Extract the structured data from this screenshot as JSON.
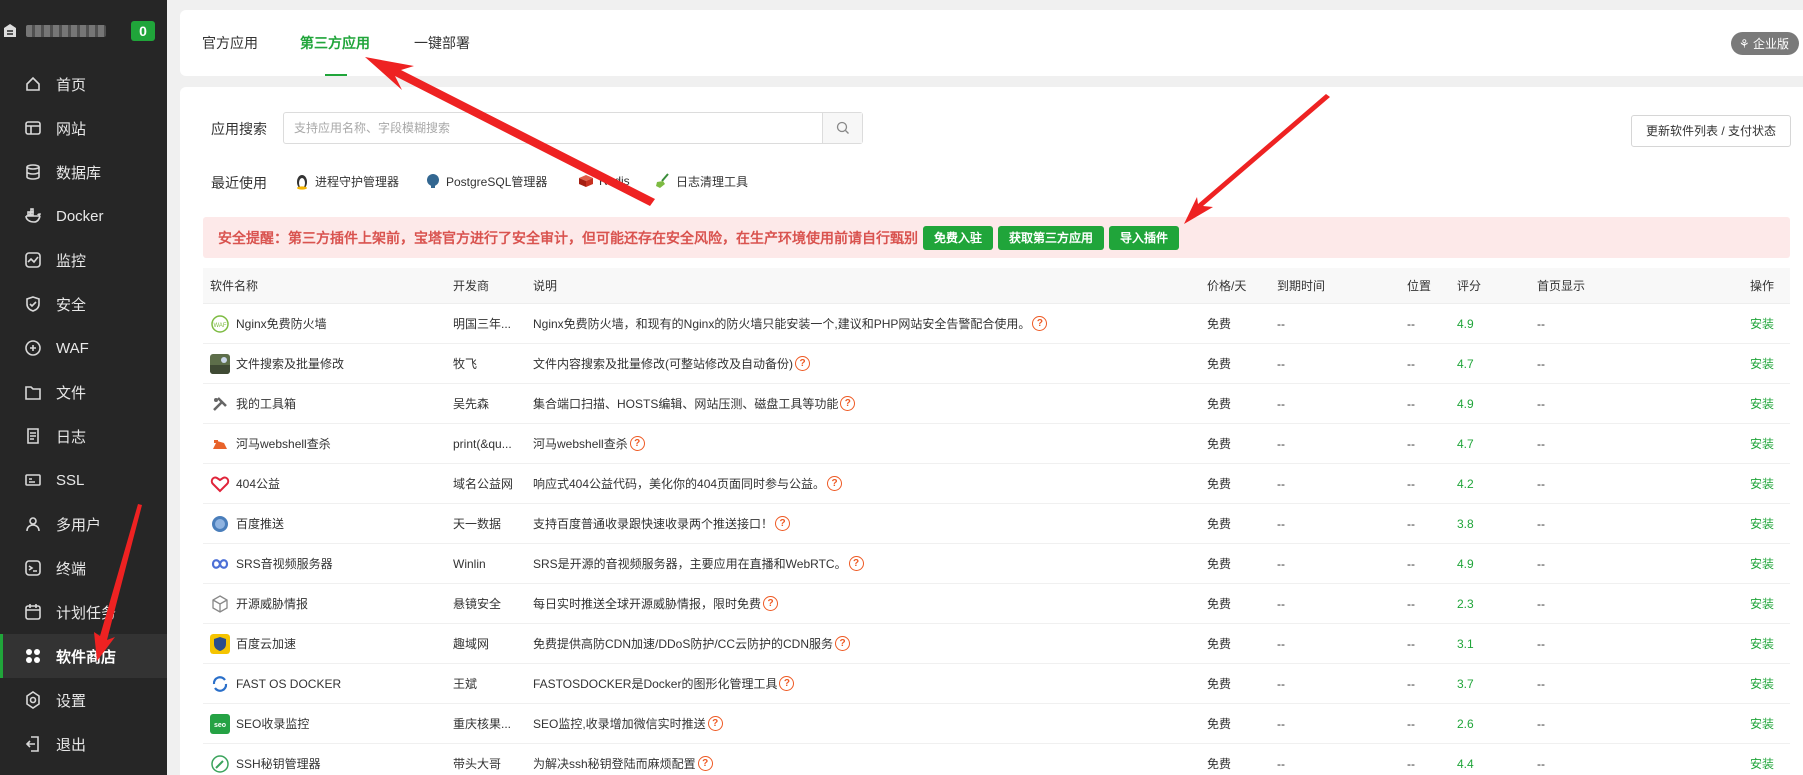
{
  "sidebar": {
    "badge": "0",
    "items": [
      {
        "label": "首页",
        "icon": "home-icon"
      },
      {
        "label": "网站",
        "icon": "website-icon"
      },
      {
        "label": "数据库",
        "icon": "database-icon"
      },
      {
        "label": "Docker",
        "icon": "docker-icon"
      },
      {
        "label": "监控",
        "icon": "monitor-icon"
      },
      {
        "label": "安全",
        "icon": "shield-icon"
      },
      {
        "label": "WAF",
        "icon": "waf-icon"
      },
      {
        "label": "文件",
        "icon": "folder-icon"
      },
      {
        "label": "日志",
        "icon": "log-icon"
      },
      {
        "label": "SSL",
        "icon": "ssl-icon"
      },
      {
        "label": "多用户",
        "icon": "user-icon"
      },
      {
        "label": "终端",
        "icon": "terminal-icon"
      },
      {
        "label": "计划任务",
        "icon": "calendar-icon"
      },
      {
        "label": "软件商店",
        "icon": "apps-icon",
        "active": true
      },
      {
        "label": "设置",
        "icon": "settings-icon"
      },
      {
        "label": "退出",
        "icon": "logout-icon"
      }
    ]
  },
  "tabs": {
    "official": "官方应用",
    "third_party": "第三方应用",
    "one_click": "一键部署",
    "enterprise": "企业版"
  },
  "search": {
    "label": "应用搜索",
    "placeholder": "支持应用名称、字段模糊搜索"
  },
  "update_button": "更新软件列表 / 支付状态",
  "recent": {
    "label": "最近使用",
    "items": [
      "进程守护管理器",
      "PostgreSQL管理器",
      "Redis",
      "日志清理工具"
    ]
  },
  "alert": {
    "text": "安全提醒：第三方插件上架前，宝塔官方进行了安全审计，但可能还存在安全风险，在生产环境使用前请自行甄别",
    "buttons": [
      "免费入驻",
      "获取第三方应用",
      "导入插件"
    ]
  },
  "table": {
    "headers": [
      "软件名称",
      "开发商",
      "说明",
      "价格/天",
      "到期时间",
      "位置",
      "评分",
      "首页显示",
      "操作"
    ],
    "rows": [
      {
        "name": "Nginx免费防火墙",
        "dev": "明国三年...",
        "desc": "Nginx免费防火墙，和现有的Nginx的防火墙只能安装一个,建议和PHP网站安全告警配合使用。",
        "price": "免费",
        "exp": "--",
        "pos": "--",
        "score": "4.9",
        "home": "--",
        "op": "安装"
      },
      {
        "name": "文件搜索及批量修改",
        "dev": "牧飞",
        "desc": "文件内容搜索及批量修改(可整站修改及自动备份)",
        "price": "免费",
        "exp": "--",
        "pos": "--",
        "score": "4.7",
        "home": "--",
        "op": "安装"
      },
      {
        "name": "我的工具箱",
        "dev": "吴先森",
        "desc": "集合端口扫描、HOSTS编辑、网站压测、磁盘工具等功能",
        "price": "免费",
        "exp": "--",
        "pos": "--",
        "score": "4.9",
        "home": "--",
        "op": "安装"
      },
      {
        "name": "河马webshell查杀",
        "dev": "print(&qu...",
        "desc": "河马webshell查杀",
        "price": "免费",
        "exp": "--",
        "pos": "--",
        "score": "4.7",
        "home": "--",
        "op": "安装"
      },
      {
        "name": "404公益",
        "dev": "域名公益网",
        "desc": "响应式404公益代码，美化你的404页面同时参与公益。",
        "price": "免费",
        "exp": "--",
        "pos": "--",
        "score": "4.2",
        "home": "--",
        "op": "安装"
      },
      {
        "name": "百度推送",
        "dev": "天一数据",
        "desc": "支持百度普通收录跟快速收录两个推送接口！",
        "price": "免费",
        "exp": "--",
        "pos": "--",
        "score": "3.8",
        "home": "--",
        "op": "安装"
      },
      {
        "name": "SRS音视频服务器",
        "dev": "Winlin",
        "desc": "SRS是开源的音视频服务器，主要应用在直播和WebRTC。",
        "price": "免费",
        "exp": "--",
        "pos": "--",
        "score": "4.9",
        "home": "--",
        "op": "安装"
      },
      {
        "name": "开源威胁情报",
        "dev": "悬镜安全",
        "desc": "每日实时推送全球开源威胁情报，限时免费",
        "price": "免费",
        "exp": "--",
        "pos": "--",
        "score": "2.3",
        "home": "--",
        "op": "安装"
      },
      {
        "name": "百度云加速",
        "dev": "趣域网",
        "desc": "免费提供高防CDN加速/DDoS防护/CC云防护的CDN服务",
        "price": "免费",
        "exp": "--",
        "pos": "--",
        "score": "3.1",
        "home": "--",
        "op": "安装"
      },
      {
        "name": "FAST OS DOCKER",
        "dev": "王斌",
        "desc": "FASTOSDOCKER是Docker的图形化管理工具",
        "price": "免费",
        "exp": "--",
        "pos": "--",
        "score": "3.7",
        "home": "--",
        "op": "安装"
      },
      {
        "name": "SEO收录监控",
        "dev": "重庆核果...",
        "desc": "SEO监控,收录增加微信实时推送",
        "price": "免费",
        "exp": "--",
        "pos": "--",
        "score": "2.6",
        "home": "--",
        "op": "安装"
      },
      {
        "name": "SSH秘钥管理器",
        "dev": "带头大哥",
        "desc": "为解决ssh秘钥登陆而麻烦配置",
        "price": "免费",
        "exp": "--",
        "pos": "--",
        "score": "4.4",
        "home": "--",
        "op": "安装"
      }
    ]
  },
  "colors": {
    "accent": "#20a53a",
    "sidebar_bg": "#262626",
    "alert_bg": "#fde9e9",
    "alert_text": "#d9534f",
    "arrow": "#ee2222"
  }
}
